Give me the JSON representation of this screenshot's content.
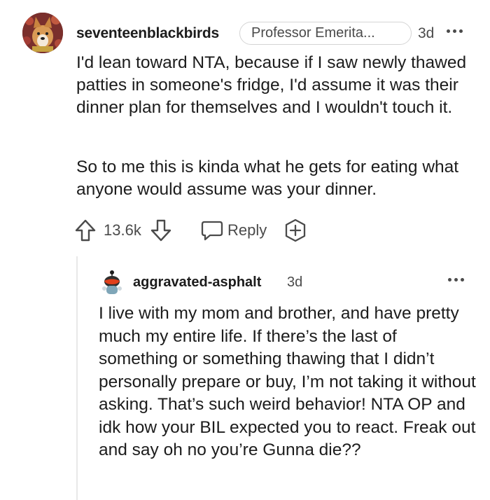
{
  "comment": {
    "author": "seventeenblackbirds",
    "flair": "Professor Emerita...",
    "time": "3d",
    "paragraphs": [
      "I'd lean toward NTA, because if I saw newly thawed patties in someone's fridge, I'd assume it was their dinner plan for themselves and I wouldn't touch it.",
      "So to me this is kinda what he gets for eating what anyone would assume was your dinner."
    ],
    "score": "13.6k",
    "reply_label": "Reply",
    "icons": {
      "upvote": "upvote-arrow-icon",
      "downvote": "downvote-arrow-icon",
      "reply": "speech-bubble-icon",
      "award": "award-plus-icon",
      "more": "more-dots-icon"
    }
  },
  "reply": {
    "author": "aggravated-asphalt",
    "time": "3d",
    "text": "I live with my mom and brother, and have pretty much my entire life. If there’s the last of something or something thawing that I didn’t personally prepare or buy, I’m not taking it without asking. That’s such weird behavior! NTA OP and idk how your BIL expected you to react. Freak out and say oh no you’re Gunna die??"
  },
  "colors": {
    "text_primary": "#1c1c1c",
    "text_secondary": "#4b4b4b",
    "flair_border": "#d4d4d4",
    "thread_line": "#e8e8e8"
  }
}
